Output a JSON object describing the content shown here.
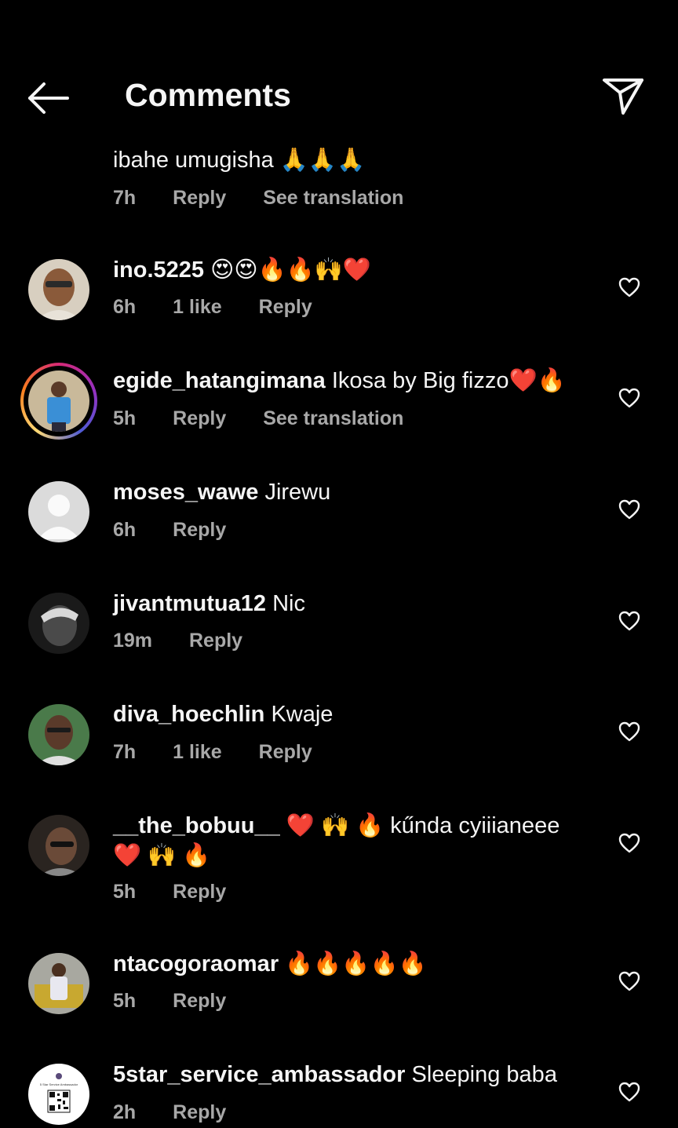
{
  "header": {
    "title": "Comments",
    "back_icon": "arrow-left-icon",
    "send_icon": "paper-plane-icon"
  },
  "partial_comment": {
    "text": "ibahe umugisha 🙏🙏🙏",
    "time": "7h",
    "reply": "Reply",
    "translate": "See translation"
  },
  "comments": [
    {
      "username": "ino.5225",
      "text": "😍😍🔥🔥🙌❤️",
      "time": "6h",
      "likes": "1 like",
      "reply": "Reply"
    },
    {
      "username": "egide_hatangimana",
      "text": "Ikosa by Big fizzo❤️🔥",
      "time": "5h",
      "reply": "Reply",
      "translate": "See translation"
    },
    {
      "username": "moses_wawe",
      "text": "Jirewu",
      "time": "6h",
      "reply": "Reply"
    },
    {
      "username": "jivantmutua12",
      "text": "Nic",
      "time": "19m",
      "reply": "Reply"
    },
    {
      "username": "diva_hoechlin",
      "text": "Kwaje",
      "time": "7h",
      "likes": "1 like",
      "reply": "Reply"
    },
    {
      "username": "__the_bobuu__",
      "text": "❤️ 🙌 🔥 kűnda cyiiianeee",
      "text2": "❤️ 🙌 🔥",
      "time": "5h",
      "reply": "Reply"
    },
    {
      "username": "ntacogoraomar",
      "text": "🔥🔥🔥🔥🔥",
      "time": "5h",
      "reply": "Reply"
    },
    {
      "username": "5star_service_ambassador",
      "text": "Sleeping baba",
      "time": "2h",
      "reply": "Reply",
      "avatar_caption": "5 Star Service Ambassador"
    }
  ],
  "colors": {
    "background": "#000000",
    "text": "#f5f5f5",
    "meta": "#a8a8a8"
  }
}
